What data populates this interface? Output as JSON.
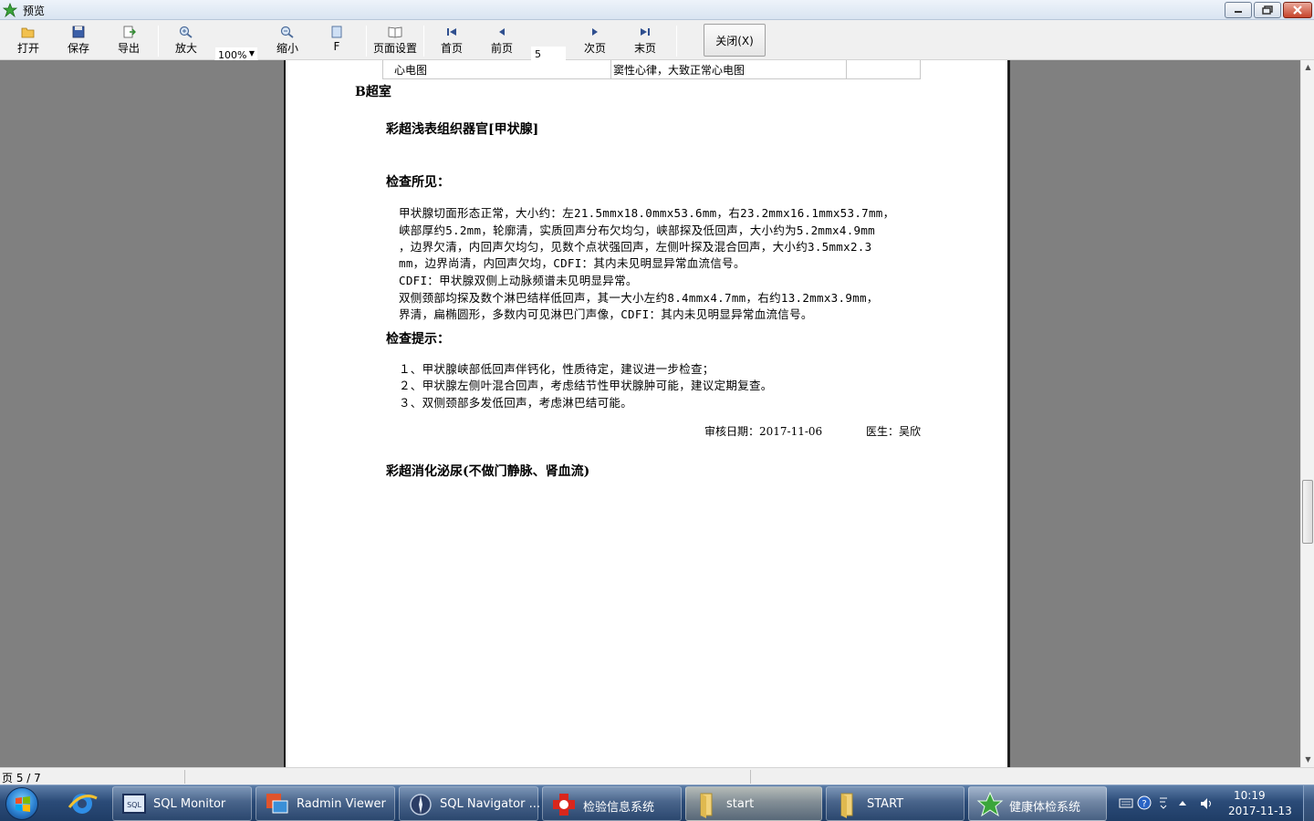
{
  "window": {
    "title": "预览"
  },
  "toolbar": {
    "open": "打开",
    "save": "保存",
    "export": "导出",
    "zoom_in": "放大",
    "zoom_value": "100%",
    "zoom_out": "缩小",
    "fit": "F",
    "page_setup": "页面设置",
    "first": "首页",
    "prev": "前页",
    "page_input": "5",
    "next": "次页",
    "last": "末页",
    "close": "关闭(X)"
  },
  "report": {
    "ecg_row": {
      "item": "心电图",
      "result": "窦性心律，大致正常心电图",
      "extra": ""
    },
    "department": "B超室",
    "exam1_title": "彩超浅表组织器官[甲状腺]",
    "findings_label": "检查所见：",
    "findings_lines": [
      "甲状腺切面形态正常，大小约：左21.5mmx18.0mmx53.6mm，右23.2mmx16.1mmx53.7mm，",
      "峡部厚约5.2mm，轮廓清，实质回声分布欠均匀，峡部探及低回声，大小约为5.2mmx4.9mm",
      "，边界欠清，内回声欠均匀，见数个点状强回声，左侧叶探及混合回声，大小约3.5mmx2.3",
      "mm，边界尚清，内回声欠均，CDFI：其内未见明显异常血流信号。",
      "CDFI：甲状腺双侧上动脉频谱未见明显异常。",
      "双侧颈部均探及数个淋巴结样低回声，其一大小左约8.4mmx4.7mm，右约13.2mmx3.9mm，",
      "界清，扁椭圆形，多数内可见淋巴门声像，CDFI：其内未见明显异常血流信号。"
    ],
    "hints_label": "检查提示：",
    "hints_lines": [
      "１、甲状腺峡部低回声伴钙化，性质待定，建议进一步检查；",
      "２、甲状腺左侧叶混合回声，考虑结节性甲状腺肿可能，建议定期复查。",
      "３、双侧颈部多发低回声，考虑淋巴结可能。"
    ],
    "review_date": "审核日期：2017-11-06",
    "doctor": "医生：吴欣",
    "exam2_title": "彩超消化泌尿(不做门静脉、肾血流)"
  },
  "statusbar": {
    "page": "页 5 / 7"
  },
  "taskbar": {
    "items": [
      {
        "label": "SQL Monitor"
      },
      {
        "label": "Radmin Viewer"
      },
      {
        "label": "SQL Navigator ..."
      },
      {
        "label": "检验信息系统"
      },
      {
        "label": "start"
      },
      {
        "label": "START"
      },
      {
        "label": "健康体检系统"
      }
    ],
    "clock_time": "10:19",
    "clock_date": "2017-11-13"
  },
  "colors": {
    "preview_bg": "#808080",
    "taskbar_bg": "#2b4b78",
    "close_red": "#c7432a"
  },
  "icons": [
    "app-icon",
    "open-folder-icon",
    "save-disk-icon",
    "export-icon",
    "zoom-in-icon",
    "zoom-out-icon",
    "fit-page-icon",
    "page-setup-icon",
    "first-page-icon",
    "prev-page-icon",
    "next-page-icon",
    "last-page-icon",
    "windows-start-icon",
    "ie-icon",
    "folder-icon"
  ]
}
